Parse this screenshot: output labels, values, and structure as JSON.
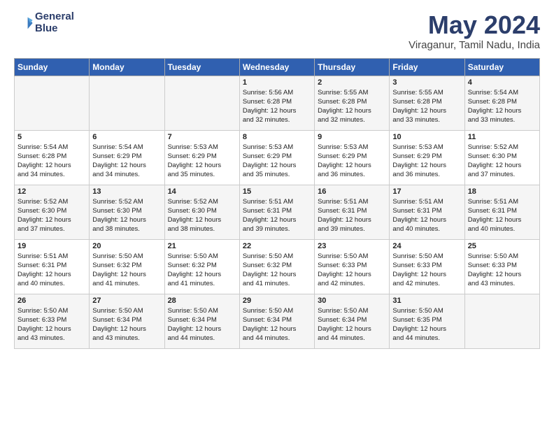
{
  "logo": {
    "line1": "General",
    "line2": "Blue"
  },
  "title": "May 2024",
  "subtitle": "Viraganur, Tamil Nadu, India",
  "headers": [
    "Sunday",
    "Monday",
    "Tuesday",
    "Wednesday",
    "Thursday",
    "Friday",
    "Saturday"
  ],
  "weeks": [
    [
      {
        "day": "",
        "info": ""
      },
      {
        "day": "",
        "info": ""
      },
      {
        "day": "",
        "info": ""
      },
      {
        "day": "1",
        "info": "Sunrise: 5:56 AM\nSunset: 6:28 PM\nDaylight: 12 hours\nand 32 minutes."
      },
      {
        "day": "2",
        "info": "Sunrise: 5:55 AM\nSunset: 6:28 PM\nDaylight: 12 hours\nand 32 minutes."
      },
      {
        "day": "3",
        "info": "Sunrise: 5:55 AM\nSunset: 6:28 PM\nDaylight: 12 hours\nand 33 minutes."
      },
      {
        "day": "4",
        "info": "Sunrise: 5:54 AM\nSunset: 6:28 PM\nDaylight: 12 hours\nand 33 minutes."
      }
    ],
    [
      {
        "day": "5",
        "info": "Sunrise: 5:54 AM\nSunset: 6:28 PM\nDaylight: 12 hours\nand 34 minutes."
      },
      {
        "day": "6",
        "info": "Sunrise: 5:54 AM\nSunset: 6:29 PM\nDaylight: 12 hours\nand 34 minutes."
      },
      {
        "day": "7",
        "info": "Sunrise: 5:53 AM\nSunset: 6:29 PM\nDaylight: 12 hours\nand 35 minutes."
      },
      {
        "day": "8",
        "info": "Sunrise: 5:53 AM\nSunset: 6:29 PM\nDaylight: 12 hours\nand 35 minutes."
      },
      {
        "day": "9",
        "info": "Sunrise: 5:53 AM\nSunset: 6:29 PM\nDaylight: 12 hours\nand 36 minutes."
      },
      {
        "day": "10",
        "info": "Sunrise: 5:53 AM\nSunset: 6:29 PM\nDaylight: 12 hours\nand 36 minutes."
      },
      {
        "day": "11",
        "info": "Sunrise: 5:52 AM\nSunset: 6:30 PM\nDaylight: 12 hours\nand 37 minutes."
      }
    ],
    [
      {
        "day": "12",
        "info": "Sunrise: 5:52 AM\nSunset: 6:30 PM\nDaylight: 12 hours\nand 37 minutes."
      },
      {
        "day": "13",
        "info": "Sunrise: 5:52 AM\nSunset: 6:30 PM\nDaylight: 12 hours\nand 38 minutes."
      },
      {
        "day": "14",
        "info": "Sunrise: 5:52 AM\nSunset: 6:30 PM\nDaylight: 12 hours\nand 38 minutes."
      },
      {
        "day": "15",
        "info": "Sunrise: 5:51 AM\nSunset: 6:31 PM\nDaylight: 12 hours\nand 39 minutes."
      },
      {
        "day": "16",
        "info": "Sunrise: 5:51 AM\nSunset: 6:31 PM\nDaylight: 12 hours\nand 39 minutes."
      },
      {
        "day": "17",
        "info": "Sunrise: 5:51 AM\nSunset: 6:31 PM\nDaylight: 12 hours\nand 40 minutes."
      },
      {
        "day": "18",
        "info": "Sunrise: 5:51 AM\nSunset: 6:31 PM\nDaylight: 12 hours\nand 40 minutes."
      }
    ],
    [
      {
        "day": "19",
        "info": "Sunrise: 5:51 AM\nSunset: 6:31 PM\nDaylight: 12 hours\nand 40 minutes."
      },
      {
        "day": "20",
        "info": "Sunrise: 5:50 AM\nSunset: 6:32 PM\nDaylight: 12 hours\nand 41 minutes."
      },
      {
        "day": "21",
        "info": "Sunrise: 5:50 AM\nSunset: 6:32 PM\nDaylight: 12 hours\nand 41 minutes."
      },
      {
        "day": "22",
        "info": "Sunrise: 5:50 AM\nSunset: 6:32 PM\nDaylight: 12 hours\nand 41 minutes."
      },
      {
        "day": "23",
        "info": "Sunrise: 5:50 AM\nSunset: 6:33 PM\nDaylight: 12 hours\nand 42 minutes."
      },
      {
        "day": "24",
        "info": "Sunrise: 5:50 AM\nSunset: 6:33 PM\nDaylight: 12 hours\nand 42 minutes."
      },
      {
        "day": "25",
        "info": "Sunrise: 5:50 AM\nSunset: 6:33 PM\nDaylight: 12 hours\nand 43 minutes."
      }
    ],
    [
      {
        "day": "26",
        "info": "Sunrise: 5:50 AM\nSunset: 6:33 PM\nDaylight: 12 hours\nand 43 minutes."
      },
      {
        "day": "27",
        "info": "Sunrise: 5:50 AM\nSunset: 6:34 PM\nDaylight: 12 hours\nand 43 minutes."
      },
      {
        "day": "28",
        "info": "Sunrise: 5:50 AM\nSunset: 6:34 PM\nDaylight: 12 hours\nand 44 minutes."
      },
      {
        "day": "29",
        "info": "Sunrise: 5:50 AM\nSunset: 6:34 PM\nDaylight: 12 hours\nand 44 minutes."
      },
      {
        "day": "30",
        "info": "Sunrise: 5:50 AM\nSunset: 6:34 PM\nDaylight: 12 hours\nand 44 minutes."
      },
      {
        "day": "31",
        "info": "Sunrise: 5:50 AM\nSunset: 6:35 PM\nDaylight: 12 hours\nand 44 minutes."
      },
      {
        "day": "",
        "info": ""
      }
    ]
  ]
}
